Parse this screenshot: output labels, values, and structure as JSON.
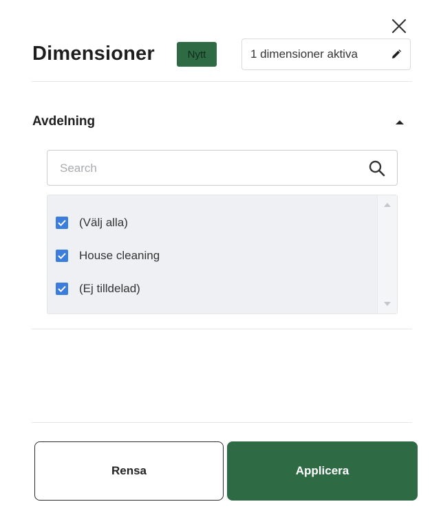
{
  "header": {
    "title": "Dimensioner",
    "badge": "Nytt",
    "active_summary": "1 dimensioner aktiva"
  },
  "section": {
    "title": "Avdelning",
    "expanded": true
  },
  "search": {
    "placeholder": "Search",
    "value": ""
  },
  "list": {
    "items": [
      {
        "label": "(Välj alla)",
        "checked": true
      },
      {
        "label": "House cleaning",
        "checked": true
      },
      {
        "label": "(Ej tilldelad)",
        "checked": true
      }
    ]
  },
  "footer": {
    "clear_label": "Rensa",
    "apply_label": "Applicera"
  },
  "colors": {
    "primary_green": "#2e6b45",
    "checkbox_blue": "#3b7ddd"
  },
  "icons": {
    "close": "close-icon",
    "edit": "pencil-icon",
    "collapse": "caret-up-icon",
    "search": "search-icon",
    "check": "check-icon"
  }
}
